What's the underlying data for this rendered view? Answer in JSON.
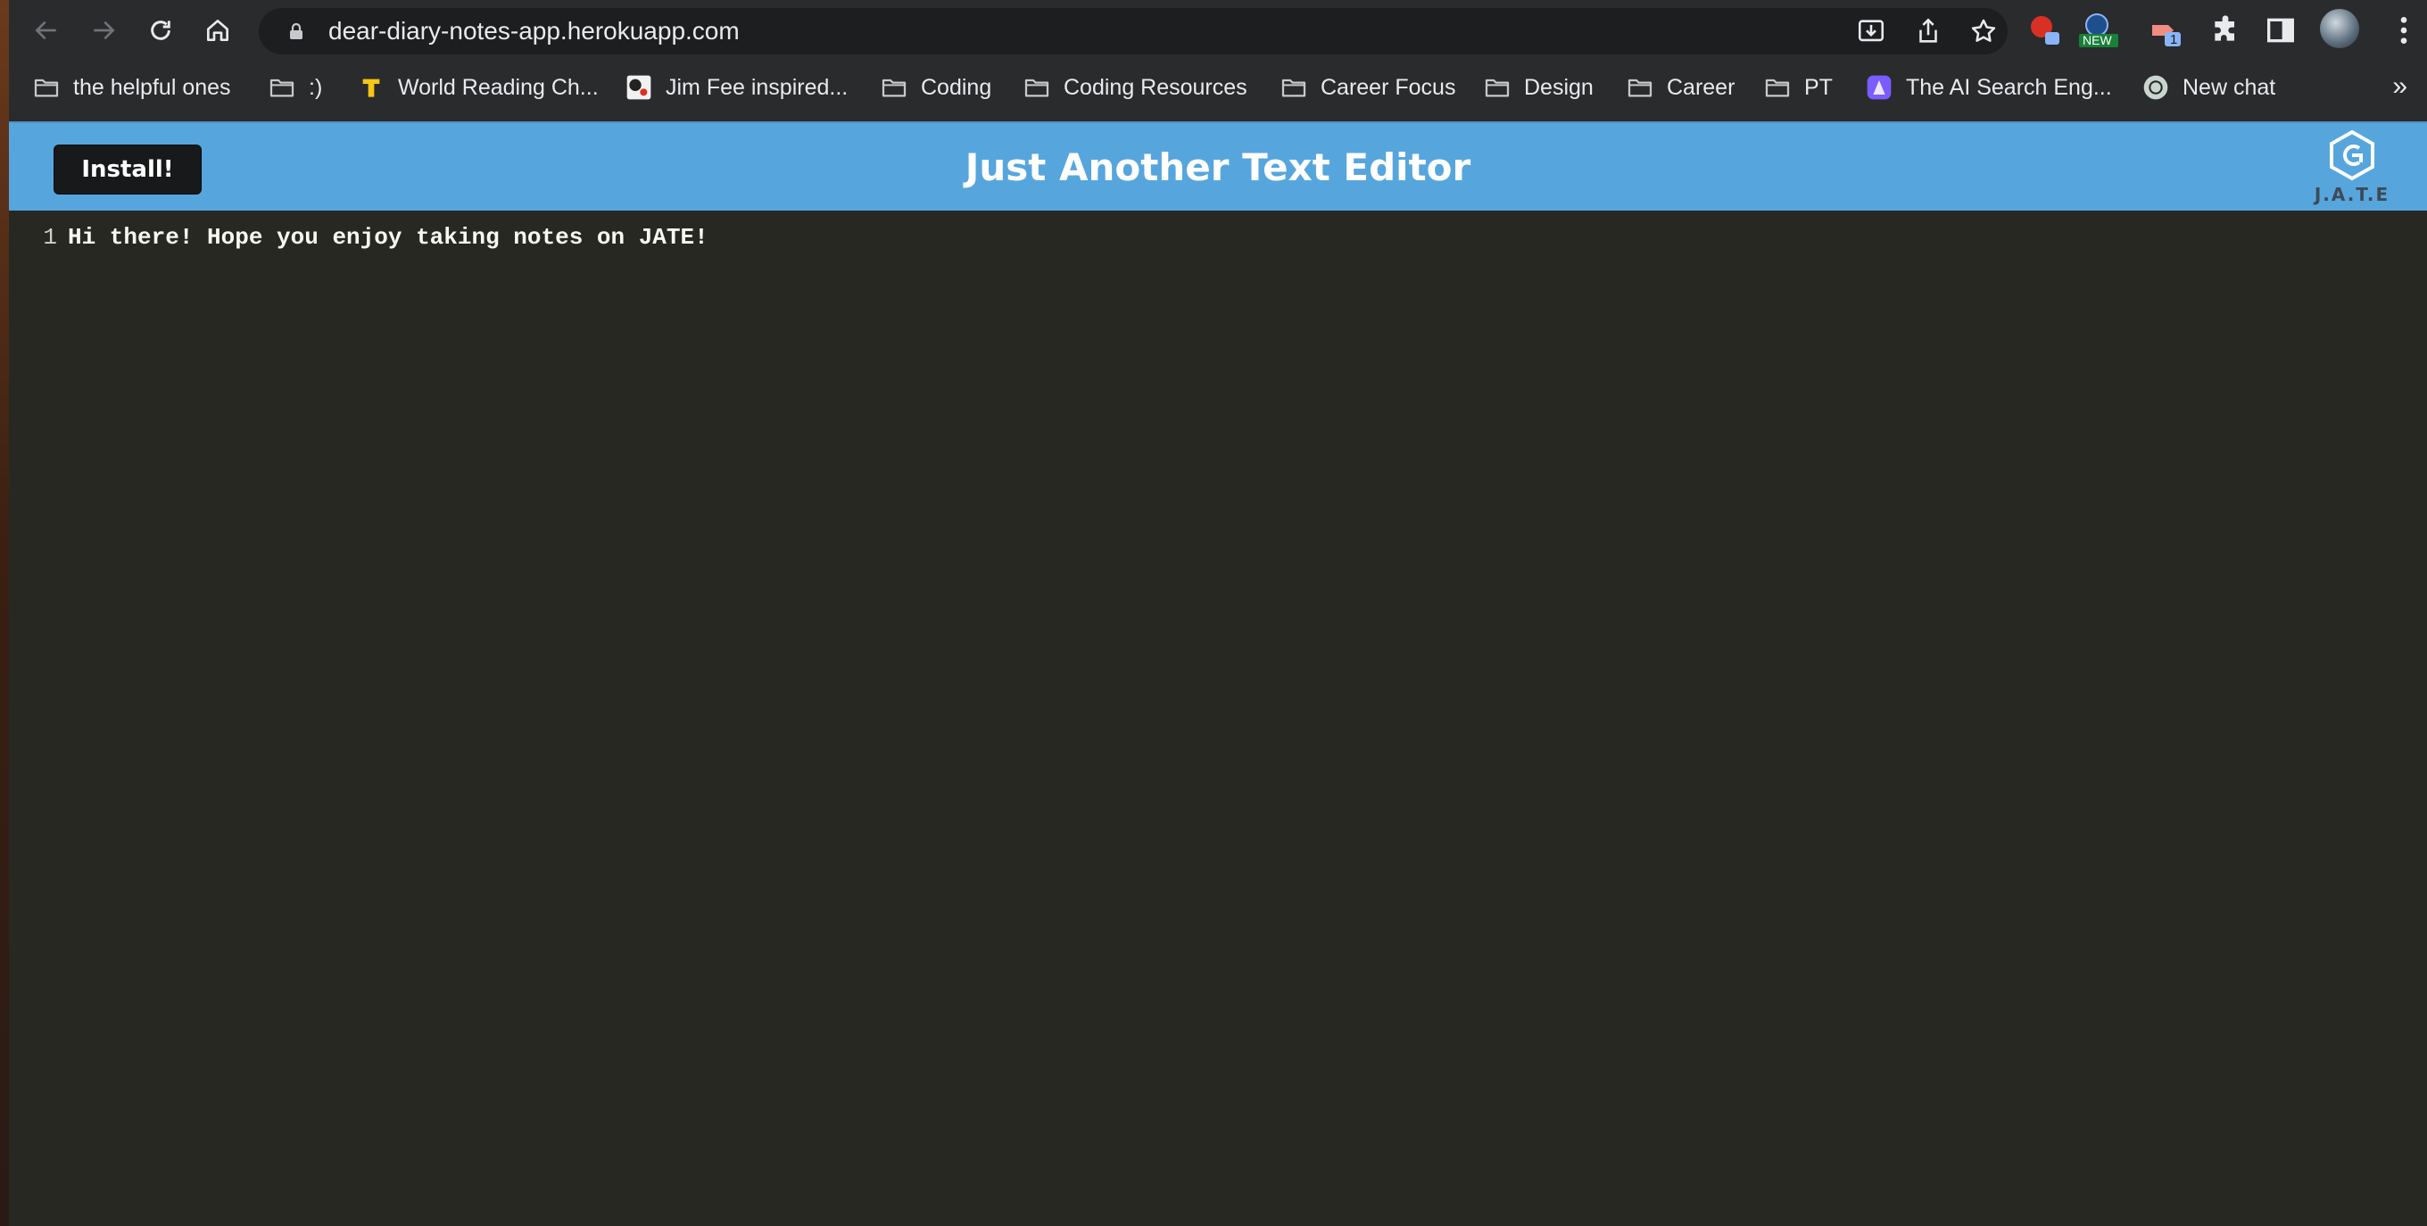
{
  "browser": {
    "url": "dear-diary-notes-app.herokuapp.com",
    "extension_badges": {
      "new_badge": "NEW",
      "count_badge": "1"
    },
    "bookmarks": [
      {
        "label": "the helpful ones",
        "icon": "folder-icon"
      },
      {
        "label": ":)",
        "icon": "folder-icon"
      },
      {
        "label": "World Reading Ch...",
        "icon": "t-logo-icon"
      },
      {
        "label": "Jim Fee inspired...",
        "icon": "site-favicon-icon"
      },
      {
        "label": "Coding",
        "icon": "folder-icon"
      },
      {
        "label": "Coding Resources",
        "icon": "folder-icon"
      },
      {
        "label": "Career Focus",
        "icon": "folder-icon"
      },
      {
        "label": "Design",
        "icon": "folder-icon"
      },
      {
        "label": "Career",
        "icon": "folder-icon"
      },
      {
        "label": "PT",
        "icon": "folder-icon"
      },
      {
        "label": "The AI Search Eng...",
        "icon": "ai-search-favicon-icon"
      },
      {
        "label": "New chat",
        "icon": "chatgpt-favicon-icon"
      }
    ],
    "more_bookmarks_glyph": "»"
  },
  "app": {
    "install_label": "Install!",
    "title": "Just Another Text Editor",
    "logo_text": "J.A.T.E",
    "brand_color": "#56a6dd"
  },
  "editor": {
    "line_numbers": [
      "1"
    ],
    "lines": [
      "Hi there! Hope you enjoy taking notes on JATE!"
    ],
    "background": "#272822"
  }
}
